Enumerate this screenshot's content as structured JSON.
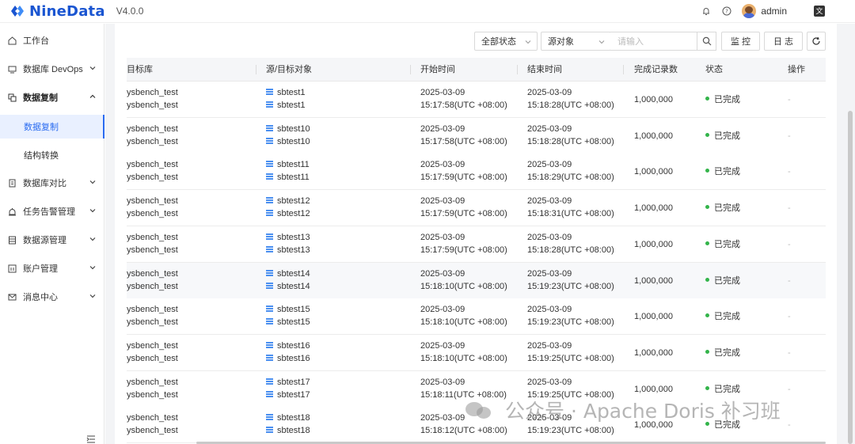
{
  "app": {
    "brand": "NineData",
    "version": "V4.0.0",
    "username": "admin",
    "accent_color": "#2a6bf0",
    "brand_color": "#1a55d1"
  },
  "sidebar": {
    "items": [
      {
        "label": "工作台",
        "icon": "home-icon"
      },
      {
        "label": "数据库 DevOps",
        "icon": "monitor-icon"
      },
      {
        "label": "数据复制",
        "icon": "copy-icon"
      },
      {
        "label": "数据复制",
        "icon": ""
      },
      {
        "label": "结构转换",
        "icon": ""
      },
      {
        "label": "数据库对比",
        "icon": "compare-icon"
      },
      {
        "label": "任务告警管理",
        "icon": "alarm-icon"
      },
      {
        "label": "数据源管理",
        "icon": "datasource-icon"
      },
      {
        "label": "账户管理",
        "icon": "account-icon"
      },
      {
        "label": "消息中心",
        "icon": "mail-icon"
      }
    ]
  },
  "toolbar": {
    "status_filter": "全部状态",
    "object_filter": "源对象",
    "search_placeholder": "请输入",
    "monitor_label": "监 控",
    "log_label": "日 志"
  },
  "table": {
    "headers": {
      "target_db": "目标库",
      "object": "源/目标对象",
      "start_time": "开始时间",
      "end_time": "结束时间",
      "records": "完成记录数",
      "status": "状态",
      "actions": "操作"
    },
    "rows": [
      {
        "db1": "ysbench_test",
        "db2": "ysbench_test",
        "obj1": "sbtest1",
        "obj2": "sbtest1",
        "start_date": "2025-03-09",
        "start_time": "15:17:58(UTC +08:00)",
        "end_date": "2025-03-09",
        "end_time": "15:18:28(UTC +08:00)",
        "records": "1,000,000",
        "status": "已完成",
        "action": "-"
      },
      {
        "db1": "ysbench_test",
        "db2": "ysbench_test",
        "obj1": "sbtest10",
        "obj2": "sbtest10",
        "start_date": "2025-03-09",
        "start_time": "15:17:58(UTC +08:00)",
        "end_date": "2025-03-09",
        "end_time": "15:18:28(UTC +08:00)",
        "records": "1,000,000",
        "status": "已完成",
        "action": "-"
      },
      {
        "db1": "ysbench_test",
        "db2": "ysbench_test",
        "obj1": "sbtest11",
        "obj2": "sbtest11",
        "start_date": "2025-03-09",
        "start_time": "15:17:59(UTC +08:00)",
        "end_date": "2025-03-09",
        "end_time": "15:18:29(UTC +08:00)",
        "records": "1,000,000",
        "status": "已完成",
        "action": "-"
      },
      {
        "db1": "ysbench_test",
        "db2": "ysbench_test",
        "obj1": "sbtest12",
        "obj2": "sbtest12",
        "start_date": "2025-03-09",
        "start_time": "15:17:59(UTC +08:00)",
        "end_date": "2025-03-09",
        "end_time": "15:18:31(UTC +08:00)",
        "records": "1,000,000",
        "status": "已完成",
        "action": "-"
      },
      {
        "db1": "ysbench_test",
        "db2": "ysbench_test",
        "obj1": "sbtest13",
        "obj2": "sbtest13",
        "start_date": "2025-03-09",
        "start_time": "15:17:59(UTC +08:00)",
        "end_date": "2025-03-09",
        "end_time": "15:18:28(UTC +08:00)",
        "records": "1,000,000",
        "status": "已完成",
        "action": "-"
      },
      {
        "db1": "ysbench_test",
        "db2": "ysbench_test",
        "obj1": "sbtest14",
        "obj2": "sbtest14",
        "start_date": "2025-03-09",
        "start_time": "15:18:10(UTC +08:00)",
        "end_date": "2025-03-09",
        "end_time": "15:19:23(UTC +08:00)",
        "records": "1,000,000",
        "status": "已完成",
        "action": "-"
      },
      {
        "db1": "ysbench_test",
        "db2": "ysbench_test",
        "obj1": "sbtest15",
        "obj2": "sbtest15",
        "start_date": "2025-03-09",
        "start_time": "15:18:10(UTC +08:00)",
        "end_date": "2025-03-09",
        "end_time": "15:19:23(UTC +08:00)",
        "records": "1,000,000",
        "status": "已完成",
        "action": "-"
      },
      {
        "db1": "ysbench_test",
        "db2": "ysbench_test",
        "obj1": "sbtest16",
        "obj2": "sbtest16",
        "start_date": "2025-03-09",
        "start_time": "15:18:10(UTC +08:00)",
        "end_date": "2025-03-09",
        "end_time": "15:19:25(UTC +08:00)",
        "records": "1,000,000",
        "status": "已完成",
        "action": "-"
      },
      {
        "db1": "ysbench_test",
        "db2": "ysbench_test",
        "obj1": "sbtest17",
        "obj2": "sbtest17",
        "start_date": "2025-03-09",
        "start_time": "15:18:11(UTC +08:00)",
        "end_date": "2025-03-09",
        "end_time": "15:19:25(UTC +08:00)",
        "records": "1,000,000",
        "status": "已完成",
        "action": "-"
      },
      {
        "db1": "ysbench_test",
        "db2": "ysbench_test",
        "obj1": "sbtest18",
        "obj2": "sbtest18",
        "start_date": "2025-03-09",
        "start_time": "15:18:12(UTC +08:00)",
        "end_date": "2025-03-09",
        "end_time": "15:19:23(UTC +08:00)",
        "records": "1,000,000",
        "status": "已完成",
        "action": "-"
      }
    ]
  },
  "watermark": {
    "text": "公众号 · Apache Doris 补习班"
  }
}
